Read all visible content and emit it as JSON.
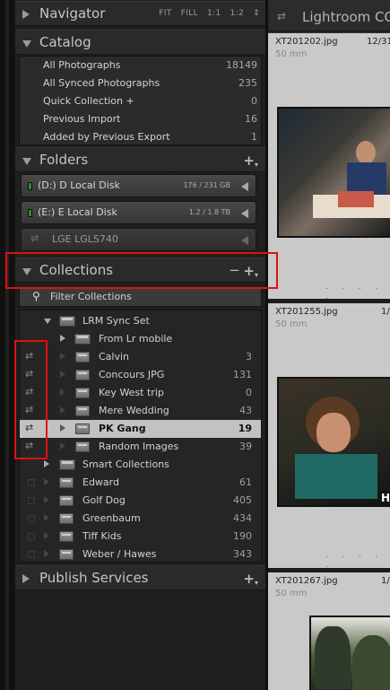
{
  "navigator": {
    "title": "Navigator",
    "opts": [
      "FIT",
      "FILL",
      "1:1",
      "1:2"
    ],
    "opts_arrow": "⇕"
  },
  "catalog": {
    "title": "Catalog",
    "items": [
      {
        "label": "All Photographs",
        "count": "18149"
      },
      {
        "label": "All Synced Photographs",
        "count": "235"
      },
      {
        "label": "Quick Collection  +",
        "count": "0"
      },
      {
        "label": "Previous Import",
        "count": "16"
      },
      {
        "label": "Added by Previous Export",
        "count": "1"
      }
    ]
  },
  "folders": {
    "title": "Folders",
    "add": "+",
    "disks": [
      {
        "name": "(D:) D Local Disk",
        "capacity": "176 / 231 GB"
      },
      {
        "name": "(E:) E Local Disk",
        "capacity": "1.2 / 1.8 TB"
      },
      {
        "name": "LGE LGLS740",
        "capacity": ""
      }
    ]
  },
  "collections": {
    "title": "Collections",
    "minus": "−",
    "add": "+",
    "filter": "Filter Collections",
    "rows": [
      {
        "label": "LRM Sync Set",
        "count": ""
      },
      {
        "label": "From Lr mobile",
        "count": ""
      },
      {
        "label": "Calvin",
        "count": "3"
      },
      {
        "label": "Concours JPG",
        "count": "131"
      },
      {
        "label": "Key West trip",
        "count": "0"
      },
      {
        "label": "Mere Wedding",
        "count": "43"
      },
      {
        "label": "PK Gang",
        "count": "19"
      },
      {
        "label": "Random Images",
        "count": "39"
      },
      {
        "label": "Smart Collections",
        "count": ""
      },
      {
        "label": "Edward",
        "count": "61"
      },
      {
        "label": "Golf Dog",
        "count": "405"
      },
      {
        "label": "Greenbaum",
        "count": "434"
      },
      {
        "label": "Tiff Kids",
        "count": "190"
      },
      {
        "label": "Weber / Hawes",
        "count": "343"
      }
    ]
  },
  "publish": {
    "title": "Publish Services",
    "add": "+"
  },
  "right_panel": {
    "title": "Lightroom CC",
    "cards": [
      {
        "filename": "XT201202.jpg",
        "date": "12/31",
        "lens": "50 mm"
      },
      {
        "filename": "XT201255.jpg",
        "date": "1/",
        "lens": "50 mm"
      },
      {
        "filename": "XT201267.jpg",
        "date": "1/",
        "lens": "50 mm"
      }
    ]
  },
  "icons": {
    "sync": "⇄",
    "search": "⚲"
  },
  "colors": {
    "highlight": "#e01010",
    "selected_row": "#c2c2c2",
    "panel_bg": "#1f1f1f"
  }
}
